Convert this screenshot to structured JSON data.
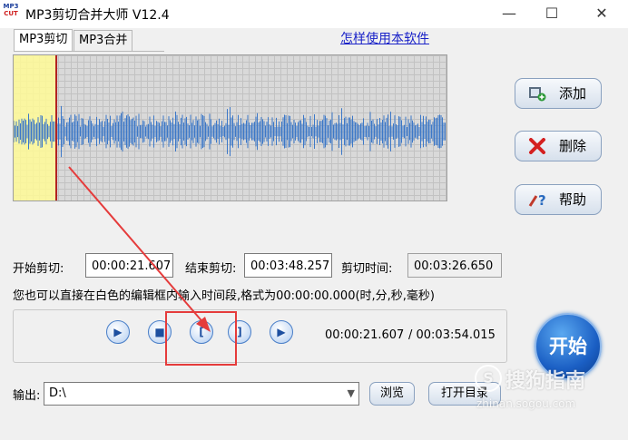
{
  "window": {
    "title": "MP3剪切合并大师 V12.4",
    "logo_top": "MP3",
    "logo_bottom": "CUT",
    "controls": [
      "—",
      "☐",
      "✕"
    ]
  },
  "tabs": [
    {
      "label": "MP3剪切",
      "active": true
    },
    {
      "label": "MP3合并",
      "active": false
    }
  ],
  "help_link": "怎样使用本软件",
  "side_buttons": {
    "add": {
      "label": "添加",
      "icon": "film-add-icon"
    },
    "delete": {
      "label": "删除",
      "icon": "red-x-icon"
    },
    "help": {
      "label": "帮助",
      "icon": "tools-help-icon"
    }
  },
  "cut": {
    "start_label": "开始剪切:",
    "start_value": "00:00:21.607",
    "end_label": "结束剪切:",
    "end_value": "00:03:48.257",
    "duration_label": "剪切时间:",
    "duration_value": "00:03:26.650",
    "hint": "您也可以直接在白色的编辑框内输入时间段,格式为00:00:00.000(时,分,秒,毫秒)"
  },
  "playback": {
    "current_time": "00:00:21.607",
    "total_time": "/ 00:03:54.015",
    "buttons": [
      "play",
      "stop",
      "mark-start",
      "mark-end",
      "play-selection"
    ]
  },
  "start_button": "开始",
  "output": {
    "label": "输出:",
    "path": "D:\\",
    "browse": "浏览",
    "open_dir": "打开目录"
  },
  "watermark": {
    "logo": "S",
    "text": "搜狗指南",
    "url": "zhinan.sogou.com"
  },
  "colors": {
    "annotation": "#e53b3b",
    "waveform": "#3c78c8",
    "selection": "#fffa96",
    "cursor": "#b22222"
  }
}
